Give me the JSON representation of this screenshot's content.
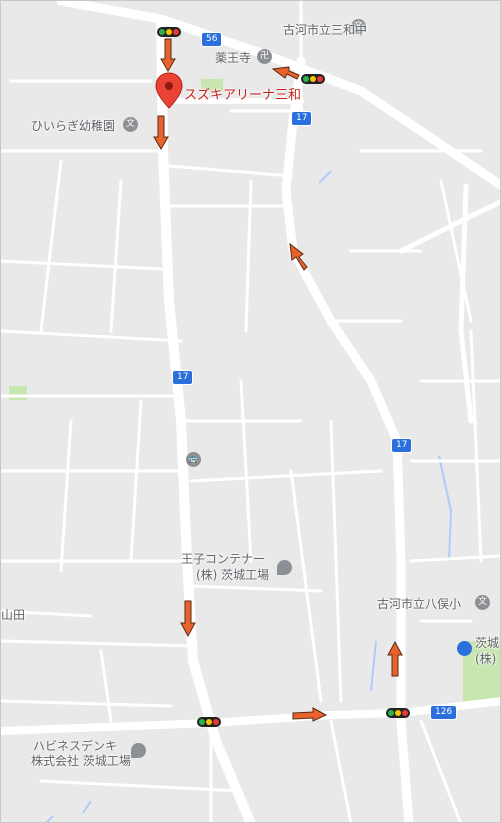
{
  "labels": {
    "school_sanwa": "古河市立三和中",
    "yakuouji": "薬王寺",
    "suzuki_arena": "スズキアリーナ三和",
    "hiiragi": "ひいらぎ幼稚園",
    "oji_container_1": "王子コンテナー",
    "oji_container_2": "(株) 茨城工場",
    "yamata_school": "古河市立八俣小",
    "ibaraki_1": "茨城",
    "ibaraki_2": "(株)",
    "yamada": "山田",
    "habinesu_1": "ハビネスデンキ",
    "habinesu_2": "株式会社 茨城工場"
  },
  "route_shields": {
    "r56": "56",
    "r17_top": "17",
    "r17_mid": "17",
    "r17_right": "17",
    "r126": "126"
  },
  "icons": {
    "school": "文",
    "temple": "卍",
    "station": "🚌"
  },
  "colors": {
    "background": "#e9e9ea",
    "road": "#ffffff",
    "water": "#aecbfa",
    "park": "#c8e6b0",
    "pin": "#ea4335",
    "arrow": "#e8622e",
    "shield": "#2a6fdb"
  }
}
